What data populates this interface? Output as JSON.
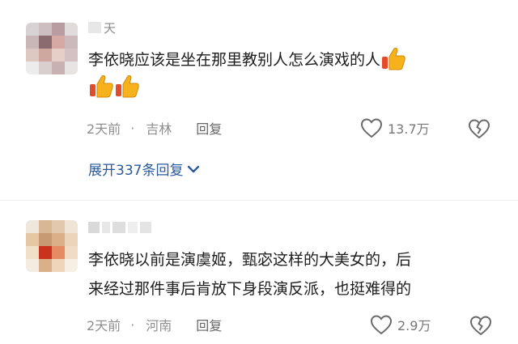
{
  "comments": [
    {
      "username_visible": "天",
      "text_lines": [
        "李依晓应该是坐在那里教别人怎么演戏的人"
      ],
      "time": "2天前",
      "location": "吉林",
      "reply_label": "回复",
      "likes": "13.7万",
      "expand_label": "展开337条回复"
    },
    {
      "username_visible": "",
      "text_lines": [
        "李依晓以前是演虞姬，甄宓这样的大美女的，后",
        "来经过那件事后肯放下身段演反派，也挺难得的"
      ],
      "time": "2天前",
      "location": "河南",
      "reply_label": "回复",
      "likes": "2.9万"
    }
  ],
  "separator": "·",
  "icons": {
    "thumbs_up": "thumbs-up-emoji",
    "like": "heart-outline-icon",
    "dislike": "broken-heart-icon",
    "expand": "chevron-down-icon"
  },
  "colors": {
    "text": "#1d1d1d",
    "meta": "#8f8f8f",
    "link": "#2b5a9b",
    "thumbs": "#f7b21b"
  }
}
